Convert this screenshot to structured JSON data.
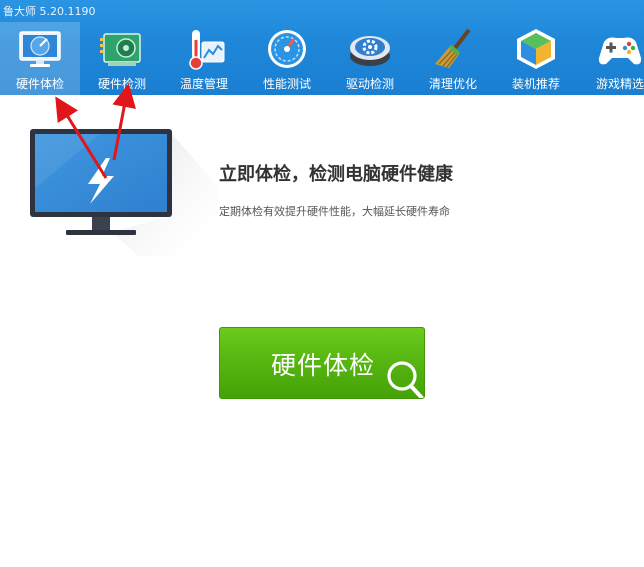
{
  "app": {
    "title": "鲁大师 5.20.1190"
  },
  "nav": {
    "items": [
      {
        "label": "硬件体检",
        "icon": "monitor-scan-icon",
        "active": true
      },
      {
        "label": "硬件检测",
        "icon": "circuit-board-icon",
        "active": false
      },
      {
        "label": "温度管理",
        "icon": "thermometer-icon",
        "active": false
      },
      {
        "label": "性能测试",
        "icon": "speedometer-icon",
        "active": false
      },
      {
        "label": "驱动检测",
        "icon": "driver-gear-icon",
        "active": false
      },
      {
        "label": "清理优化",
        "icon": "broom-icon",
        "active": false
      },
      {
        "label": "装机推荐",
        "icon": "cube-icon",
        "active": false
      },
      {
        "label": "游戏精选",
        "icon": "gamepad-icon",
        "active": false
      }
    ]
  },
  "hero": {
    "headline": "立即体检，检测电脑硬件健康",
    "subline": "定期体检有效提升硬件性能，大幅延长硬件寿命"
  },
  "action": {
    "label": "硬件体检"
  },
  "colors": {
    "topbar": "#1f86d8",
    "button_green": "#57b711",
    "annotation_red": "#e0161b",
    "monitor_screen": "#3a8ed6"
  }
}
